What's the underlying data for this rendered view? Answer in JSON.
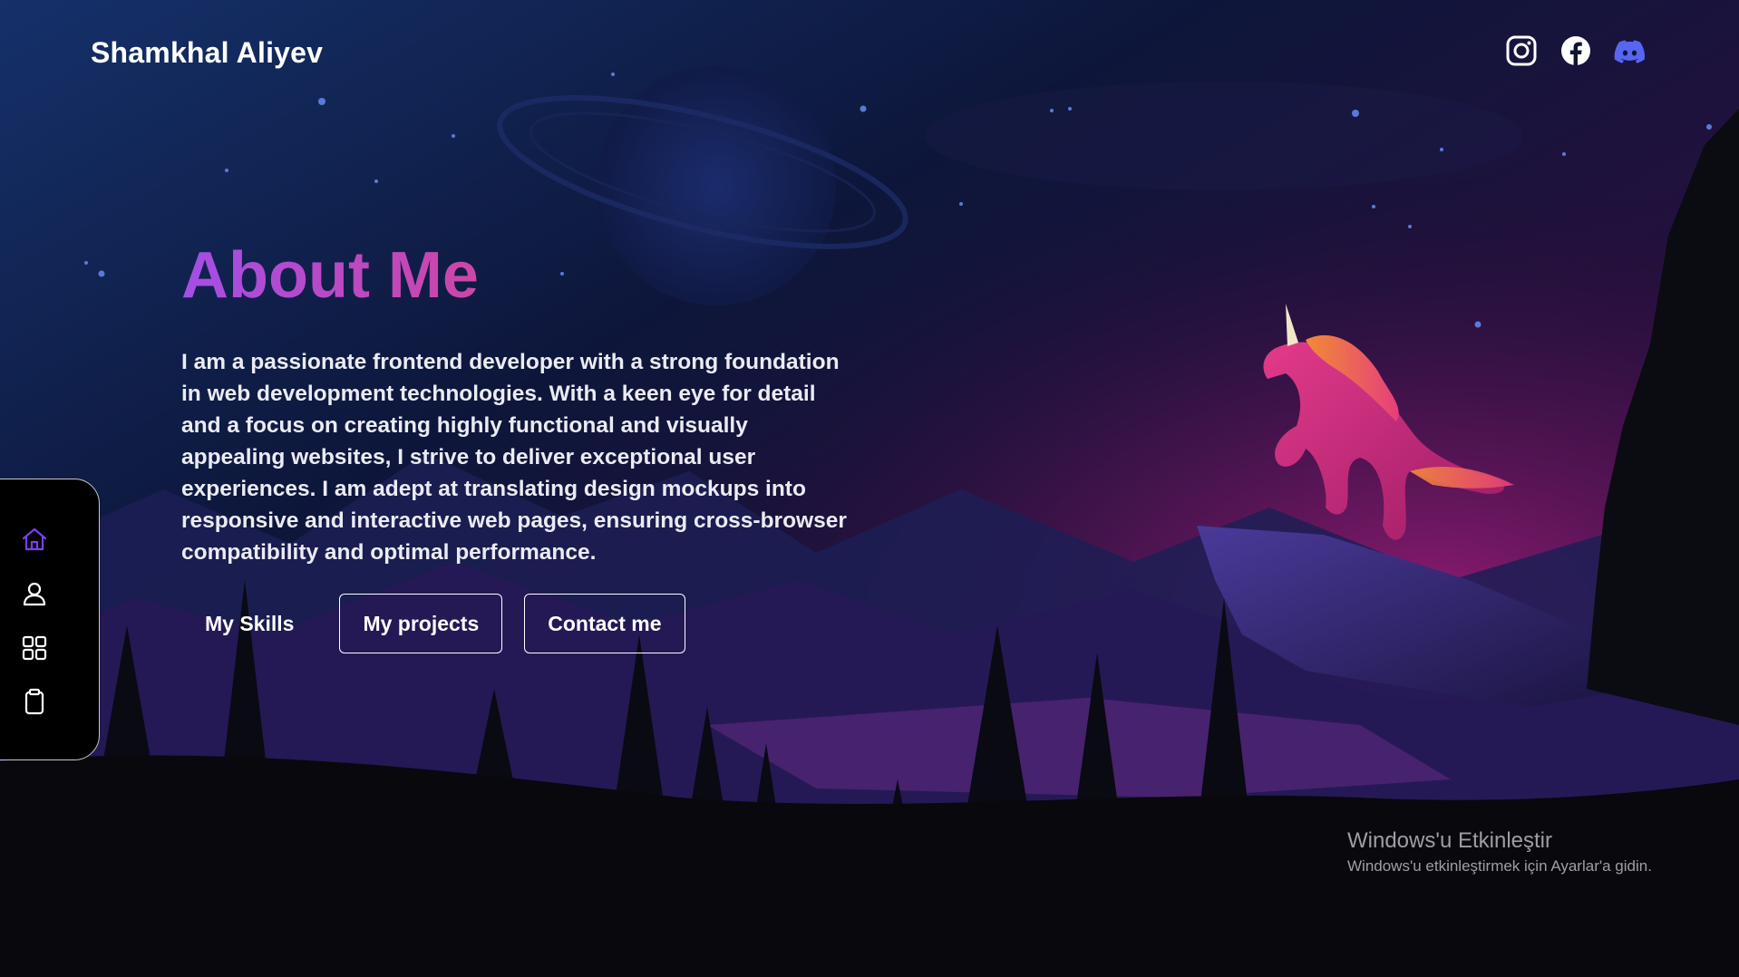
{
  "header": {
    "brand": "Shamkhal Aliyev",
    "socials": [
      {
        "name": "instagram-icon"
      },
      {
        "name": "facebook-icon"
      },
      {
        "name": "discord-icon"
      }
    ]
  },
  "hero": {
    "title": "About Me",
    "text": "I am a passionate frontend developer with a strong foundation in web development technologies. With a keen eye for detail and a focus on creating highly functional and visually appealing websites, I strive to deliver exceptional user experiences. I am adept at translating design mockups into responsive and interactive web pages, ensuring cross-browser compatibility and optimal performance.",
    "buttons": {
      "skills": "My Skills",
      "projects": "My projects",
      "contact": "Contact me"
    }
  },
  "sidebar": {
    "items": [
      {
        "name": "home-icon",
        "active": true
      },
      {
        "name": "user-icon",
        "active": false
      },
      {
        "name": "grid-icon",
        "active": false
      },
      {
        "name": "clipboard-icon",
        "active": false
      }
    ]
  },
  "activation": {
    "title": "Windows'u Etkinleştir",
    "subtitle": "Windows'u etkinleştirmek için Ayarlar'a gidin."
  },
  "colors": {
    "title_gradient_start": "#a44ee6",
    "title_gradient_end": "#ef3f47",
    "active_icon": "#7b3ff2",
    "discord": "#5865f2"
  }
}
